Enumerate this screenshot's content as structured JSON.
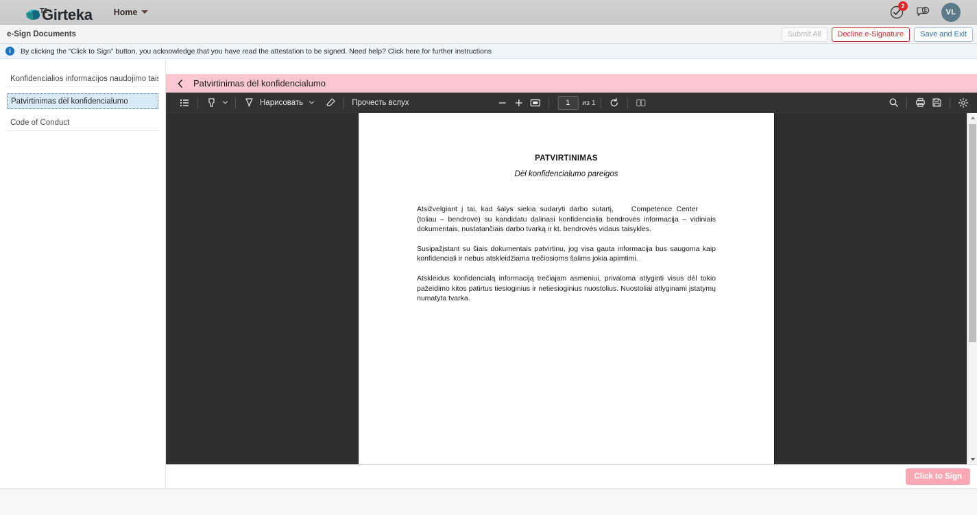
{
  "topnav": {
    "brand_superscript": "T2",
    "brand_name": "Girteka",
    "brand_icon": "girteka-leaf-logo",
    "home_label": "Home",
    "notifications_badge": "2",
    "notifications_icon": "check-circle-icon",
    "chat_icon": "chat-smiley-icon",
    "avatar_initials": "VL"
  },
  "esign": {
    "title": "e-Sign Documents",
    "submit_all_label": "Submit All",
    "decline_label": "Decline e-Signature",
    "save_exit_label": "Save and Exit"
  },
  "info": {
    "icon": "info-icon",
    "glyph": "i",
    "text": "By clicking the “Click to Sign” button, you acknowledge that you have read the attestation to be signed. Need help? Click here for further instructions"
  },
  "sidebar": {
    "items": [
      {
        "label": "Konfidencialios informacijos naudojimo taisyklė",
        "active": false
      },
      {
        "label": "Patvirtinimas dėl konfidencialumo",
        "active": true
      },
      {
        "label": "Code of Conduct",
        "active": false
      }
    ]
  },
  "doc_header": {
    "back_icon": "chevron-left-icon",
    "title": "Patvirtinimas dėl konfidencialumo"
  },
  "pdf_toolbar": {
    "list_icon": "table-of-contents-icon",
    "highlighter_icon": "highlighter-icon",
    "highlighter_chevron_icon": "chevron-down-icon",
    "draw_icon": "pen-icon",
    "draw_label": "Нарисовать",
    "draw_chevron_icon": "chevron-down-icon",
    "erase_icon": "eraser-icon",
    "read_aloud_label": "Прочесть вслух",
    "zoom_out_icon": "minus-icon",
    "zoom_in_icon": "plus-icon",
    "fit_page_icon": "fit-page-icon",
    "page_value": "1",
    "page_total": "из 1",
    "rotate_icon": "rotate-icon",
    "layout_icon": "page-layout-icon",
    "search_icon": "search-icon",
    "print_icon": "print-icon",
    "save_icon": "save-icon",
    "settings_icon": "gear-icon"
  },
  "document": {
    "title": "PATVIRTINIMAS",
    "subtitle": "Dėl konfidencialumo pareigos",
    "paragraphs": [
      "Atsižvelgiant į tai, kad šalys siekia sudaryti darbo sutartį,",
      "Competence Center",
      "(toliau – bendrovė) su kandidatu dalinasi konfidencialia bendrovės informacija – vidiniais dokumentais, nustatančiais darbo tvarką ir kt. bendrovės vidaus taisykles.",
      "Susipažįstant su šiais dokumentais patvirtinu, jog visa gauta informacija bus saugoma kaip konfidenciali ir nebus atskleidžiama trečiosioms šalims jokia apimtimi.",
      "Atskleidus konfidencialą informaciją trečiajam asmeniui, privaloma atlyginti visus dėl tokio pažeidimo kitos patirtus tiesioginius ir netiesioginius nuostolius. Nuostoliai atlyginami įstatymų numatyta tvarka."
    ]
  },
  "footer": {
    "sign_label": "Click to Sign"
  },
  "colors": {
    "pink_header": "#fbc7cf",
    "sign_button": "#f9a8b4",
    "info_bar": "#eef5fd",
    "decline_red": "#c9302c",
    "save_blue": "#2f6fa8",
    "badge_red": "#e8202a",
    "avatar": "#5c7a8a",
    "pdf_chrome": "#323232"
  }
}
